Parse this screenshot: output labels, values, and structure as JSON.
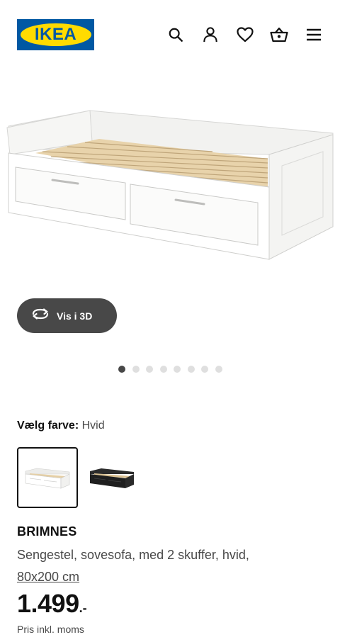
{
  "header": {
    "logo_text": "IKEA",
    "icons": [
      "search-icon",
      "user-icon",
      "heart-icon",
      "basket-icon",
      "menu-icon"
    ]
  },
  "gallery": {
    "view_3d_label": "Vis i 3D",
    "dot_count": 8,
    "active_dot": 0
  },
  "color_picker": {
    "label": "Vælg farve:",
    "selected_value": "Hvid",
    "options": [
      "Hvid",
      "Sort"
    ]
  },
  "product": {
    "name": "BRIMNES",
    "description": "Sengestel, sovesofa, med 2 skuffer, hvid,",
    "size_link": "80x200 cm",
    "price_main": "1.499",
    "price_suffix": ".-",
    "price_note": "Pris inkl. moms"
  },
  "colors": {
    "brand_blue": "#0058a3",
    "brand_yellow": "#ffdb00",
    "dark_button": "#484848",
    "text": "#111111"
  }
}
